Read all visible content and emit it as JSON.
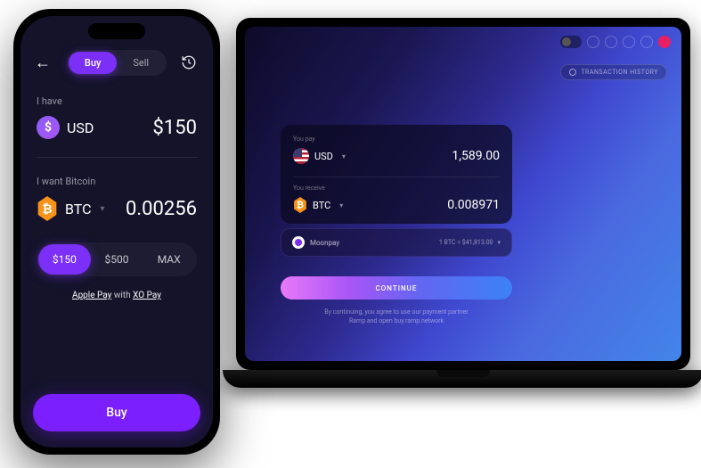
{
  "phone": {
    "tabs": {
      "buy": "Buy",
      "sell": "Sell"
    },
    "have": {
      "label": "I have",
      "currency": "USD",
      "symbol": "$",
      "amount": "$150"
    },
    "want": {
      "label": "I want Bitcoin",
      "currency": "BTC",
      "symbol": "₿",
      "amount": "0.00256"
    },
    "quick": [
      "$150",
      "$500",
      "MAX"
    ],
    "pay": {
      "apple": "Apple Pay",
      "with": " with ",
      "xo": "XO Pay"
    },
    "cta": "Buy"
  },
  "desktop": {
    "history": "TRANSACTION HISTORY",
    "pay": {
      "label": "You pay",
      "currency": "USD",
      "amount": "1,589.00"
    },
    "receive": {
      "label": "You receive",
      "currency": "BTC",
      "symbol": "₿",
      "amount": "0.008971"
    },
    "provider": {
      "name": "Moonpay",
      "rate": "1 BTC = $41,813.00"
    },
    "continue": "CONTINUE",
    "disclaimer1": "By continuing, you agree to use our payment partner",
    "disclaimer2": "Ramp and open buy.ramp.network"
  }
}
